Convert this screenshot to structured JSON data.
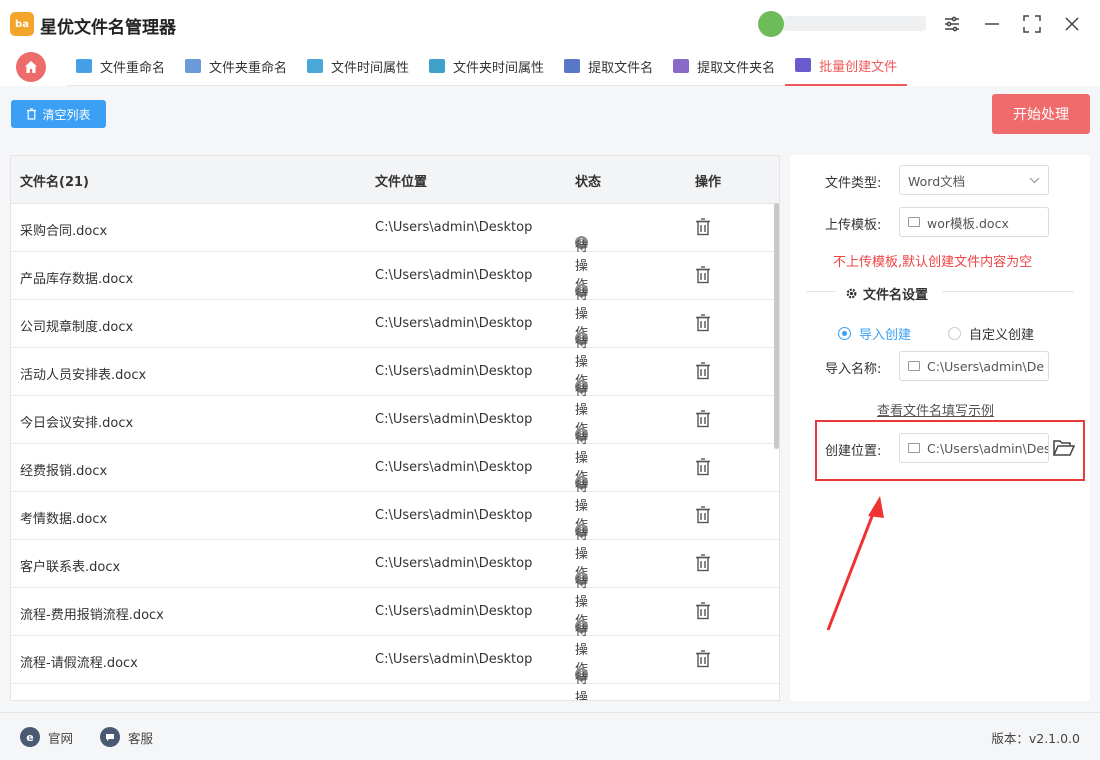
{
  "app": {
    "title": "星优文件名管理器",
    "logo_text": "ba"
  },
  "tabs": [
    {
      "label": "文件重命名",
      "color": "#46a0e8"
    },
    {
      "label": "文件夹重命名",
      "color": "#6a9ad8"
    },
    {
      "label": "文件时间属性",
      "color": "#4aa8d8"
    },
    {
      "label": "文件夹时间属性",
      "color": "#3fa0c8"
    },
    {
      "label": "提取文件名",
      "color": "#5a78c8"
    },
    {
      "label": "提取文件夹名",
      "color": "#8a6ac8"
    },
    {
      "label": "批量创建文件",
      "color": "#6a5ad0",
      "active": true
    }
  ],
  "toolbar": {
    "clear_label": "清空列表",
    "start_label": "开始处理"
  },
  "table": {
    "headers": {
      "name": "文件名(21)",
      "location": "文件位置",
      "status": "状态",
      "action": "操作"
    },
    "rows": [
      {
        "name": "采购合同.docx",
        "location": "C:\\Users\\admin\\Desktop",
        "status": "待操作"
      },
      {
        "name": "产品库存数据.docx",
        "location": "C:\\Users\\admin\\Desktop",
        "status": "待操作"
      },
      {
        "name": "公司规章制度.docx",
        "location": "C:\\Users\\admin\\Desktop",
        "status": "待操作"
      },
      {
        "name": "活动人员安排表.docx",
        "location": "C:\\Users\\admin\\Desktop",
        "status": "待操作"
      },
      {
        "name": "今日会议安排.docx",
        "location": "C:\\Users\\admin\\Desktop",
        "status": "待操作"
      },
      {
        "name": "经费报销.docx",
        "location": "C:\\Users\\admin\\Desktop",
        "status": "待操作"
      },
      {
        "name": "考情数据.docx",
        "location": "C:\\Users\\admin\\Desktop",
        "status": "待操作"
      },
      {
        "name": "客户联系表.docx",
        "location": "C:\\Users\\admin\\Desktop",
        "status": "待操作"
      },
      {
        "name": "流程-费用报销流程.docx",
        "location": "C:\\Users\\admin\\Desktop",
        "status": "待操作"
      },
      {
        "name": "流程-请假流程.docx",
        "location": "C:\\Users\\admin\\Desktop",
        "status": "待操作"
      }
    ]
  },
  "panel": {
    "file_type_label": "文件类型:",
    "file_type_value": "Word文档",
    "upload_label": "上传模板:",
    "upload_value": "wor模板.docx",
    "warning": "不上传模板,默认创建文件内容为空",
    "section_title": "文件名设置",
    "radio_import": "导入创建",
    "radio_custom": "自定义创建",
    "import_label": "导入名称:",
    "import_value": "C:\\Users\\admin\\De",
    "example_link": "查看文件名填写示例",
    "location_label": "创建位置:",
    "location_value": "C:\\Users\\admin\\Des"
  },
  "footer": {
    "website": "官网",
    "service": "客服",
    "version": "版本：v2.1.0.0"
  }
}
